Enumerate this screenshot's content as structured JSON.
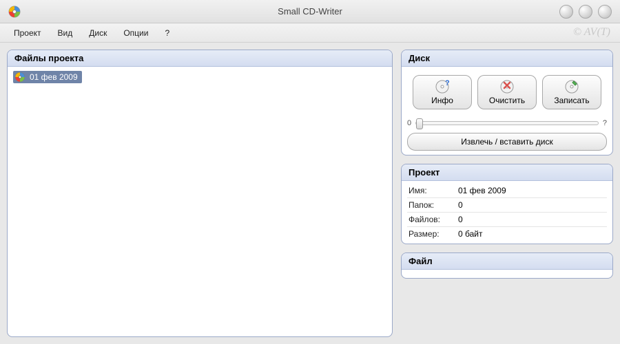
{
  "window": {
    "title": "Small CD-Writer",
    "watermark": "© AV(T)"
  },
  "menu": {
    "items": [
      "Проект",
      "Вид",
      "Диск",
      "Опции",
      "?"
    ]
  },
  "project_files": {
    "title": "Файлы проекта",
    "root_label": "01 фев 2009"
  },
  "disc_panel": {
    "title": "Диск",
    "info_label": "Инфо",
    "clear_label": "Очистить",
    "write_label": "Записать",
    "slider_min": "0",
    "slider_max": "?",
    "eject_label": "Извлечь / вставить диск"
  },
  "project_panel": {
    "title": "Проект",
    "rows": [
      {
        "label": "Имя:",
        "value": "01 фев 2009"
      },
      {
        "label": "Папок:",
        "value": "0"
      },
      {
        "label": "Файлов:",
        "value": "0"
      },
      {
        "label": "Размер:",
        "value": "0 байт"
      }
    ]
  },
  "file_panel": {
    "title": "Файл"
  }
}
